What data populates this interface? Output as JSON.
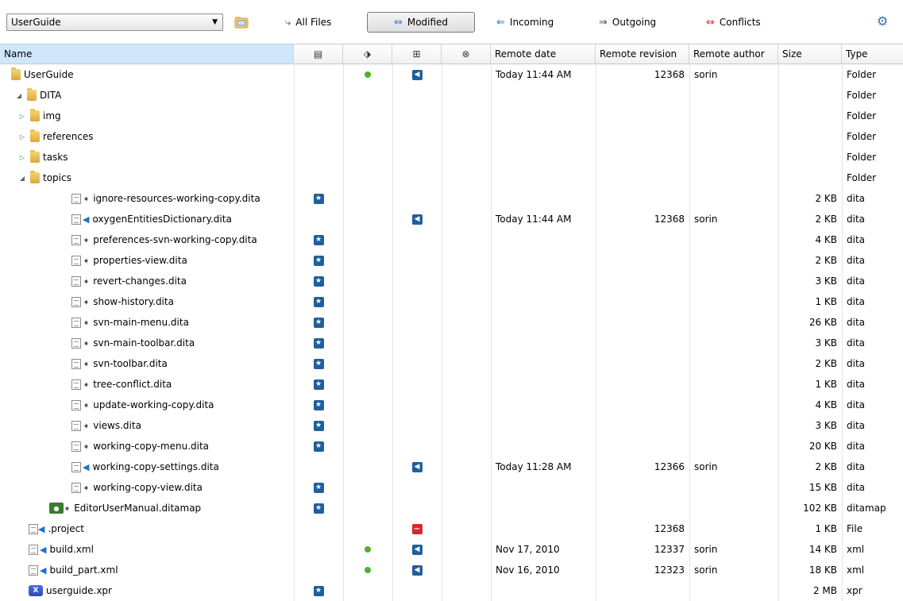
{
  "toolbar": {
    "workspace": "UserGuide",
    "all_files": "All Files",
    "modified": "Modified",
    "incoming": "Incoming",
    "outgoing": "Outgoing",
    "conflicts": "Conflicts"
  },
  "columns": {
    "name": "Name",
    "remote_date": "Remote date",
    "remote_revision": "Remote revision",
    "remote_author": "Remote author",
    "size": "Size",
    "type": "Type"
  },
  "rows": [
    {
      "name": "UserGuide",
      "kind": "folder",
      "depth": 0,
      "twisty": "",
      "dot": true,
      "incoming": "blue",
      "date": "Today  11:44 AM",
      "revision": "12368",
      "author": "sorin",
      "size": "",
      "type": "Folder"
    },
    {
      "name": "DITA",
      "kind": "folder",
      "depth": 1,
      "twisty": "◢",
      "dot": false,
      "incoming": "",
      "date": "",
      "revision": "",
      "author": "",
      "size": "",
      "type": "Folder"
    },
    {
      "name": "img",
      "kind": "folder",
      "depth": 2,
      "twisty": "▷",
      "type": "Folder"
    },
    {
      "name": "references",
      "kind": "folder",
      "depth": 2,
      "twisty": "▷",
      "type": "Folder"
    },
    {
      "name": "tasks",
      "kind": "folder",
      "depth": 2,
      "twisty": "▷",
      "type": "Folder"
    },
    {
      "name": "topics",
      "kind": "folder",
      "depth": 2,
      "twisty": "◢",
      "type": "Folder"
    },
    {
      "name": "ignore-resources-working-copy.dita",
      "kind": "file-out",
      "depth": 4,
      "local": true,
      "size": "2 KB",
      "type": "dita"
    },
    {
      "name": "oxygenEntitiesDictionary.dita",
      "kind": "file-in",
      "depth": 4,
      "incoming": "blue",
      "date": "Today  11:44 AM",
      "revision": "12368",
      "author": "sorin",
      "size": "2 KB",
      "type": "dita"
    },
    {
      "name": "preferences-svn-working-copy.dita",
      "kind": "file-out",
      "depth": 4,
      "local": true,
      "size": "4 KB",
      "type": "dita"
    },
    {
      "name": "properties-view.dita",
      "kind": "file-out",
      "depth": 4,
      "local": true,
      "size": "2 KB",
      "type": "dita"
    },
    {
      "name": "revert-changes.dita",
      "kind": "file-out",
      "depth": 4,
      "local": true,
      "size": "3 KB",
      "type": "dita"
    },
    {
      "name": "show-history.dita",
      "kind": "file-out",
      "depth": 4,
      "local": true,
      "size": "1 KB",
      "type": "dita"
    },
    {
      "name": "svn-main-menu.dita",
      "kind": "file-out",
      "depth": 4,
      "local": true,
      "size": "26 KB",
      "type": "dita"
    },
    {
      "name": "svn-main-toolbar.dita",
      "kind": "file-out",
      "depth": 4,
      "local": true,
      "size": "3 KB",
      "type": "dita"
    },
    {
      "name": "svn-toolbar.dita",
      "kind": "file-out",
      "depth": 4,
      "local": true,
      "size": "2 KB",
      "type": "dita"
    },
    {
      "name": "tree-conflict.dita",
      "kind": "file-out",
      "depth": 4,
      "local": true,
      "size": "1 KB",
      "type": "dita"
    },
    {
      "name": "update-working-copy.dita",
      "kind": "file-out",
      "depth": 4,
      "local": true,
      "size": "4 KB",
      "type": "dita"
    },
    {
      "name": "views.dita",
      "kind": "file-out",
      "depth": 4,
      "local": true,
      "size": "3 KB",
      "type": "dita"
    },
    {
      "name": "working-copy-menu.dita",
      "kind": "file-out",
      "depth": 4,
      "local": true,
      "size": "20 KB",
      "type": "dita"
    },
    {
      "name": "working-copy-settings.dita",
      "kind": "file-in",
      "depth": 4,
      "incoming": "blue",
      "date": "Today  11:28 AM",
      "revision": "12366",
      "author": "sorin",
      "size": "2 KB",
      "type": "dita"
    },
    {
      "name": "working-copy-view.dita",
      "kind": "file-out",
      "depth": 4,
      "local": true,
      "size": "15 KB",
      "type": "dita"
    },
    {
      "name": "EditorUserManual.ditamap",
      "kind": "ditamap",
      "depth": 3,
      "local": true,
      "size": "102 KB",
      "type": "ditamap"
    },
    {
      "name": ".project",
      "kind": "file-in-plain",
      "depth": 1,
      "incoming": "red",
      "revision": "12368",
      "size": "1 KB",
      "type": "File"
    },
    {
      "name": "build.xml",
      "kind": "file-in",
      "depth": 1,
      "dot": true,
      "incoming": "blue",
      "date": "Nov 17, 2010",
      "revision": "12337",
      "author": "sorin",
      "size": "14 KB",
      "type": "xml"
    },
    {
      "name": "build_part.xml",
      "kind": "file-in",
      "depth": 1,
      "dot": true,
      "incoming": "blue",
      "date": "Nov 16, 2010",
      "revision": "12323",
      "author": "sorin",
      "size": "18 KB",
      "type": "xml"
    },
    {
      "name": "userguide.xpr",
      "kind": "xpr",
      "depth": 1,
      "local": true,
      "size": "2 MB",
      "type": "xpr"
    }
  ],
  "colors": {
    "header_name_bg": "#cfe6fb",
    "incoming_blue": "#1f5f9e",
    "conflict_red": "#d62828",
    "status_green": "#4fb02b"
  },
  "icons": [
    "folder-icon",
    "dita-file-icon",
    "outgoing-arrow-icon",
    "incoming-arrow-icon",
    "local-modified-badge-icon",
    "incoming-modified-badge-icon",
    "incoming-deleted-badge-icon",
    "status-dot-icon",
    "settings-gear-icon"
  ]
}
